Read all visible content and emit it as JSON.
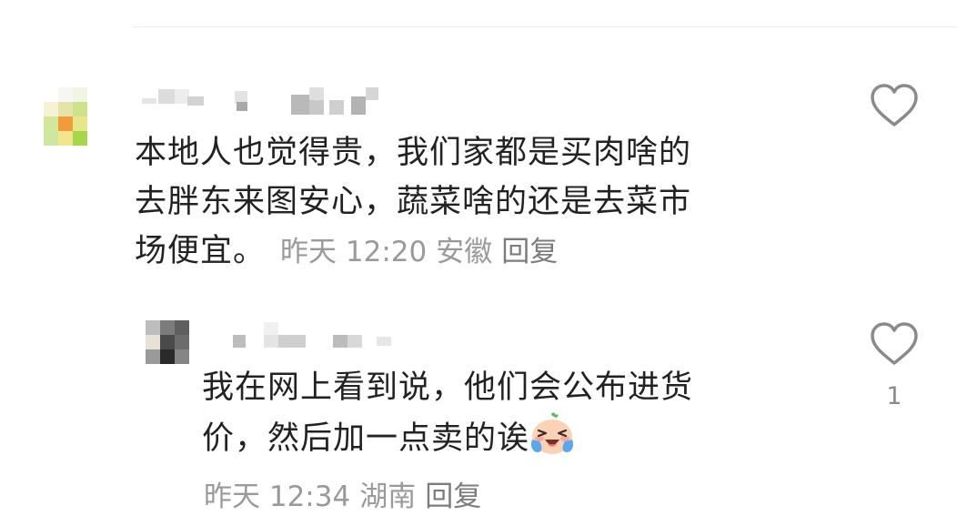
{
  "comments": [
    {
      "text_lines": [
        "本地人也觉得贵，我们家都是买肉啥的",
        "去胖东来图安心，蔬菜啥的还是去菜市",
        "场便宜。"
      ],
      "time": "昨天 12:20",
      "location": "安徽",
      "reply_label": "回复"
    },
    {
      "text_lines": [
        "我在网上看到说，他们会公布进货",
        "价，然后加一点卖的诶"
      ],
      "time": "昨天 12:34",
      "location": "湖南",
      "reply_label": "回复",
      "like_count": "1"
    }
  ],
  "colors": {
    "text": "#222222",
    "meta": "#9a9a9a",
    "icon": "#8a8a8a"
  },
  "icons": [
    "heart-outline-icon",
    "crying-laughing-emoji"
  ]
}
